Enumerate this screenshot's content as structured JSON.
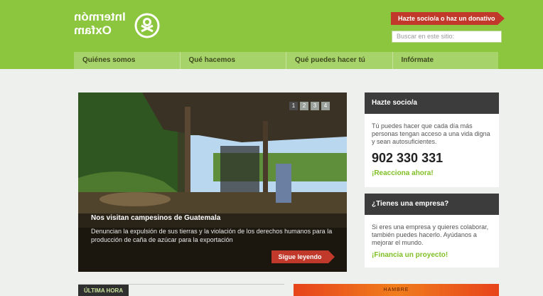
{
  "header": {
    "logo_text": "Intermón Oxfam",
    "cta_label": "Hazte socio/a o haz un donativo",
    "search_placeholder": "Buscar en este sitio:"
  },
  "nav": {
    "items": [
      {
        "label": "Quiénes somos"
      },
      {
        "label": "Qué hacemos"
      },
      {
        "label": "Qué puedes hacer tú"
      },
      {
        "label": "Infórmate"
      }
    ]
  },
  "slider": {
    "pager": [
      "1",
      "2",
      "3",
      "4"
    ],
    "title": "Nos visitan campesinos de Guatemala",
    "description": "Denuncian la expulsión de sus tierras y la violación de los derechos humanos para la producción de caña de azúcar para la exportación",
    "more_label": "Sigue leyendo"
  },
  "member_box": {
    "title": "Hazte socio/a",
    "text": "Tú puedes hacer que cada día más personas tengan acceso a una vida digna y sean autosuficientes.",
    "phone": "902 330 331",
    "link": "¡Reacciona ahora!"
  },
  "company_box": {
    "title": "¿Tienes una empresa?",
    "text": "Si eres una empresa y quieres colaborar, también puedes hacerlo. Ayúdanos a mejorar el mundo.",
    "link": "¡Financia un proyecto!"
  },
  "ticker": {
    "label": "ÚLTIMA HORA"
  },
  "banner": {
    "text": "HAMBRE"
  },
  "colors": {
    "brand_green": "#8cc63f",
    "accent_red": "#c0392b",
    "dark": "#3c3c3c"
  }
}
